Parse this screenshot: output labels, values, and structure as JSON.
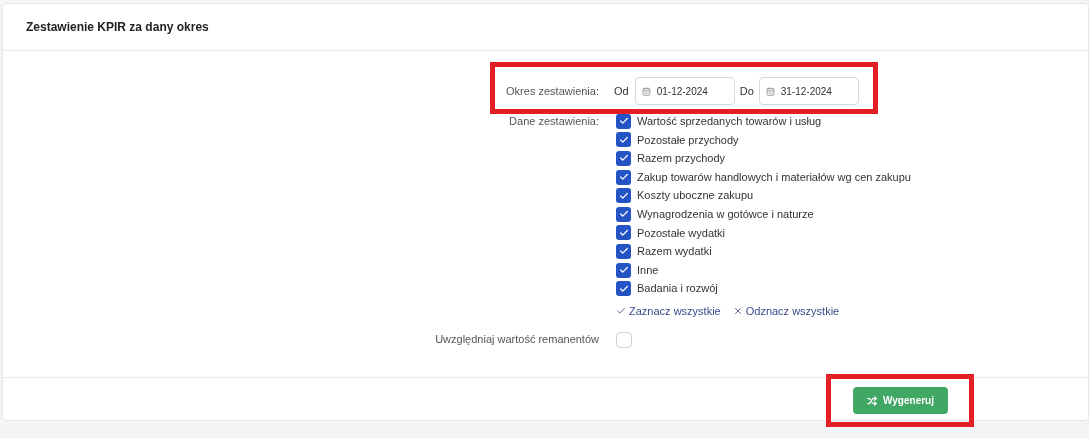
{
  "card": {
    "title": "Zestawienie KPIR za dany okres"
  },
  "period": {
    "label": "Okres zestawienia:",
    "highlighted": true,
    "from_label": "Od",
    "from_value": "01-12-2024",
    "to_label": "Do",
    "to_value": "31-12-2024"
  },
  "data": {
    "label": "Dane zestawienia:",
    "options": [
      {
        "label": "Wartość sprzedanych towarów i usług",
        "checked": true
      },
      {
        "label": "Pozostałe przychody",
        "checked": true
      },
      {
        "label": "Razem przychody",
        "checked": true
      },
      {
        "label": "Zakup towarów handlowych i materiałów wg cen zakupu",
        "checked": true
      },
      {
        "label": "Koszty uboczne zakupu",
        "checked": true
      },
      {
        "label": "Wynagrodzenia w gotówce i naturze",
        "checked": true
      },
      {
        "label": "Pozostałe wydatki",
        "checked": true
      },
      {
        "label": "Razem wydatki",
        "checked": true
      },
      {
        "label": "Inne",
        "checked": true
      },
      {
        "label": "Badania i rozwój",
        "checked": true
      }
    ],
    "select_all": "Zaznacz wszystkie",
    "deselect_all": "Odznacz wszystkie"
  },
  "remanent": {
    "label": "Uwzględniaj wartość remanentów",
    "checked": false
  },
  "generate_button": {
    "label": "Wygeneruj",
    "highlighted": true
  }
}
